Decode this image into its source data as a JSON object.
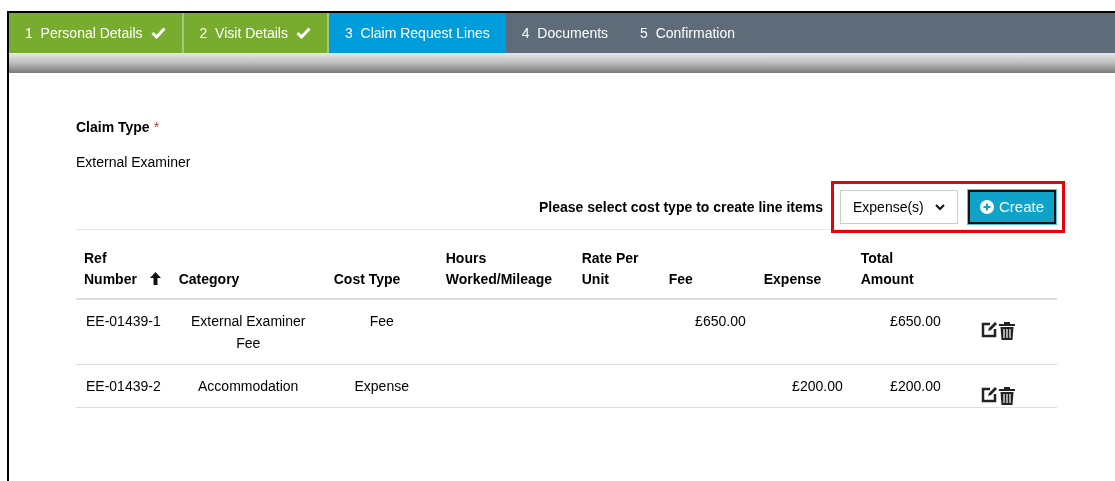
{
  "steps": [
    {
      "number": "1",
      "label": "Personal Details",
      "completed": true,
      "selected": false
    },
    {
      "number": "2",
      "label": "Visit Details",
      "completed": true,
      "selected": false
    },
    {
      "number": "3",
      "label": "Claim Request Lines",
      "completed": false,
      "selected": true
    },
    {
      "number": "4",
      "label": "Documents",
      "completed": false,
      "selected": false
    },
    {
      "number": "5",
      "label": "Confirmation",
      "completed": false,
      "selected": false
    }
  ],
  "claim_type": {
    "label": "Claim Type",
    "required_mark": "*",
    "value": "External Examiner"
  },
  "create_bar": {
    "prompt": "Please select cost type to create line items",
    "select_value": "Expense(s)",
    "button": "Create",
    "highlighted": true
  },
  "table": {
    "columns": [
      {
        "label": "Ref Number",
        "sorted": true
      },
      {
        "label": "Category",
        "sorted": false
      },
      {
        "label": "Cost Type",
        "sorted": false
      },
      {
        "label": "Hours Worked/Mileage",
        "sorted": false
      },
      {
        "label": "Rate Per Unit",
        "sorted": false
      },
      {
        "label": "Fee",
        "sorted": false
      },
      {
        "label": "Expense",
        "sorted": false
      },
      {
        "label": "Total Amount",
        "sorted": false
      }
    ],
    "rows": [
      {
        "cells": [
          "EE-01439-1",
          "External Examiner Fee",
          "Fee",
          "",
          "",
          "£650.00",
          "",
          "£650.00"
        ]
      },
      {
        "cells": [
          "EE-01439-2",
          "Accommodation",
          "Expense",
          "",
          "",
          "",
          "£200.00",
          "£200.00"
        ]
      }
    ]
  }
}
